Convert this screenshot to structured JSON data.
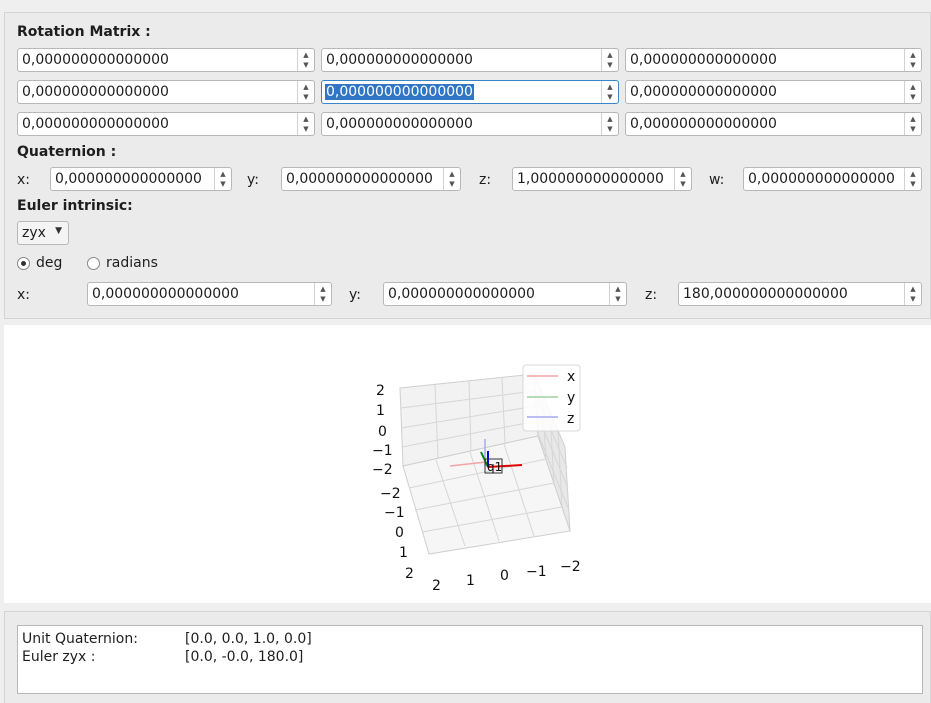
{
  "rotation_matrix": {
    "label": "Rotation Matrix :",
    "cells": [
      [
        "0,000000000000000",
        "0,000000000000000",
        "0,000000000000000"
      ],
      [
        "0,000000000000000",
        "0,000000000000000",
        "0,000000000000000"
      ],
      [
        "0,000000000000000",
        "0,000000000000000",
        "0,000000000000000"
      ]
    ]
  },
  "quaternion": {
    "label": "Quaternion :",
    "x_label": "x:",
    "x": "0,000000000000000",
    "y_label": "y:",
    "y": "0,000000000000000",
    "z_label": "z:",
    "z": "1,000000000000000",
    "w_label": "w:",
    "w": "0,000000000000000"
  },
  "euler": {
    "label": "Euler intrinsic:",
    "order": "zyx",
    "deg_label": "deg",
    "radians_label": "radians",
    "selected_unit": "deg",
    "x_label": "x:",
    "x": "0,000000000000000",
    "y_label": "y:",
    "y": "0,000000000000000",
    "z_label": "z:",
    "z": "180,000000000000000"
  },
  "plot": {
    "z_ticks": [
      "2",
      "1",
      "0",
      "−1",
      "−2"
    ],
    "left_axis_ticks": [
      "−2",
      "−1",
      "0",
      "1",
      "2"
    ],
    "bottom_axis_ticks": [
      "2",
      "1",
      "0",
      "−1",
      "−2"
    ],
    "legend": [
      {
        "label": "x",
        "color": "#f4a3a3"
      },
      {
        "label": "y",
        "color": "#9fd09f"
      },
      {
        "label": "z",
        "color": "#a8a8f4"
      }
    ],
    "frame_label": "q1",
    "axis_colors": {
      "x": "#e00000",
      "y": "#008800",
      "z": "#0000ee"
    }
  },
  "output": {
    "unit_quaternion_label": "Unit Quaternion:",
    "unit_quaternion_value": "[0.0, 0.0, 1.0, 0.0]",
    "euler_label": "Euler zyx :",
    "euler_value": "[0.0, -0.0, 180.0]"
  }
}
